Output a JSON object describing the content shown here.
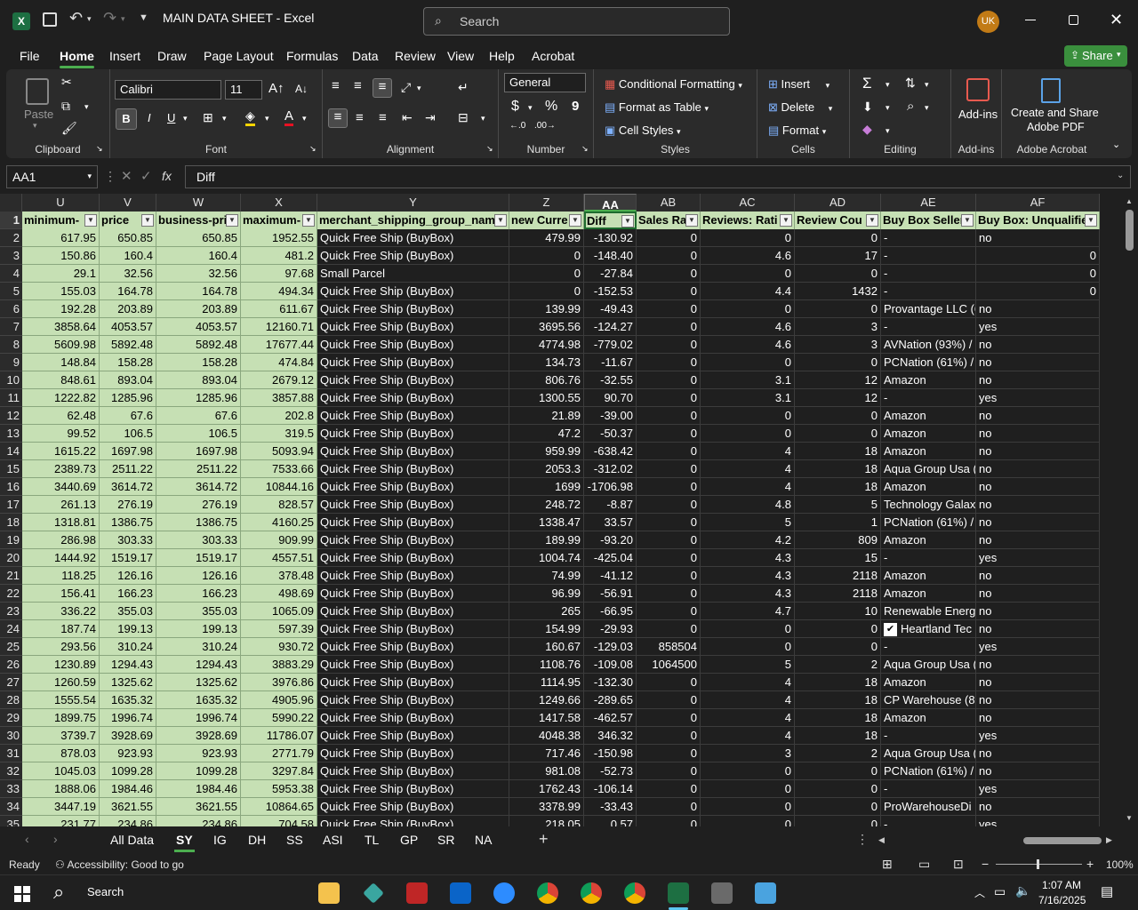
{
  "titlebar": {
    "filename": "MAIN DATA SHEET",
    "sep": "-",
    "app": "Excel",
    "search_placeholder": "Search",
    "avatar": "UK"
  },
  "menu": {
    "tabs": [
      "File",
      "Home",
      "Insert",
      "Draw",
      "Page Layout",
      "Formulas",
      "Data",
      "Review",
      "View",
      "Help",
      "Acrobat"
    ],
    "share": "Share"
  },
  "ribbon": {
    "clipboard": {
      "paste": "Paste",
      "label": "Clipboard"
    },
    "font": {
      "name": "Calibri",
      "size": "11",
      "label": "Font",
      "bold": "B",
      "italic": "I",
      "underline": "U"
    },
    "alignment": {
      "label": "Alignment"
    },
    "number": {
      "format": "General",
      "label": "Number",
      "currency": "$",
      "percent": "%",
      "comma": "9"
    },
    "styles": {
      "conditional": "Conditional Formatting",
      "format_table": "Format as Table",
      "cell_styles": "Cell Styles",
      "label": "Styles"
    },
    "cells": {
      "insert": "Insert",
      "delete": "Delete",
      "format": "Format",
      "label": "Cells"
    },
    "editing": {
      "label": "Editing"
    },
    "addins": {
      "addins": "Add-ins",
      "label": "Add-ins"
    },
    "acrobat": {
      "create": "Create and Share",
      "pdf": "Adobe PDF",
      "label": "Adobe Acrobat"
    }
  },
  "formula_bar": {
    "name_box": "AA1",
    "fx": "fx",
    "content": "Diff"
  },
  "columns": [
    "U",
    "V",
    "W",
    "X",
    "Y",
    "Z",
    "AA",
    "AB",
    "AC",
    "AD",
    "AE",
    "AF"
  ],
  "headers": [
    "minimum-",
    "price",
    "business-pri",
    "maximum-",
    "merchant_shipping_group_nam",
    "new Curre",
    "Diff",
    "Sales Ra",
    "Reviews: Rati",
    "Review Cou",
    "Buy Box Seller",
    "Buy Box: Unqualifie"
  ],
  "rows": [
    [
      "617.95",
      "650.85",
      "650.85",
      "1952.55",
      "Quick Free Ship (BuyBox)",
      "479.99",
      "-130.92",
      "0",
      "0",
      "0",
      "-",
      "no"
    ],
    [
      "150.86",
      "160.4",
      "160.4",
      "481.2",
      "Quick Free Ship (BuyBox)",
      "0",
      "-148.40",
      "0",
      "4.6",
      "17",
      "-",
      "0"
    ],
    [
      "29.1",
      "32.56",
      "32.56",
      "97.68",
      "Small Parcel",
      "0",
      "-27.84",
      "0",
      "0",
      "0",
      "-",
      "0"
    ],
    [
      "155.03",
      "164.78",
      "164.78",
      "494.34",
      "Quick Free Ship (BuyBox)",
      "0",
      "-152.53",
      "0",
      "4.4",
      "1432",
      "-",
      "0"
    ],
    [
      "192.28",
      "203.89",
      "203.89",
      "611.67",
      "Quick Free Ship (BuyBox)",
      "139.99",
      "-49.43",
      "0",
      "0",
      "0",
      "Provantage LLC (6",
      "no"
    ],
    [
      "3858.64",
      "4053.57",
      "4053.57",
      "12160.71",
      "Quick Free Ship (BuyBox)",
      "3695.56",
      "-124.27",
      "0",
      "4.6",
      "3",
      "-",
      "yes"
    ],
    [
      "5609.98",
      "5892.48",
      "5892.48",
      "17677.44",
      "Quick Free Ship (BuyBox)",
      "4774.98",
      "-779.02",
      "0",
      "4.6",
      "3",
      "AVNation (93%) /",
      "no"
    ],
    [
      "148.84",
      "158.28",
      "158.28",
      "474.84",
      "Quick Free Ship (BuyBox)",
      "134.73",
      "-11.67",
      "0",
      "0",
      "0",
      "PCNation (61%) /",
      "no"
    ],
    [
      "848.61",
      "893.04",
      "893.04",
      "2679.12",
      "Quick Free Ship (BuyBox)",
      "806.76",
      "-32.55",
      "0",
      "3.1",
      "12",
      "Amazon",
      "no"
    ],
    [
      "1222.82",
      "1285.96",
      "1285.96",
      "3857.88",
      "Quick Free Ship (BuyBox)",
      "1300.55",
      "90.70",
      "0",
      "3.1",
      "12",
      "-",
      "yes"
    ],
    [
      "62.48",
      "67.6",
      "67.6",
      "202.8",
      "Quick Free Ship (BuyBox)",
      "21.89",
      "-39.00",
      "0",
      "0",
      "0",
      "Amazon",
      "no"
    ],
    [
      "99.52",
      "106.5",
      "106.5",
      "319.5",
      "Quick Free Ship (BuyBox)",
      "47.2",
      "-50.37",
      "0",
      "0",
      "0",
      "Amazon",
      "no"
    ],
    [
      "1615.22",
      "1697.98",
      "1697.98",
      "5093.94",
      "Quick Free Ship (BuyBox)",
      "959.99",
      "-638.42",
      "0",
      "4",
      "18",
      "Amazon",
      "no"
    ],
    [
      "2389.73",
      "2511.22",
      "2511.22",
      "7533.66",
      "Quick Free Ship (BuyBox)",
      "2053.3",
      "-312.02",
      "0",
      "4",
      "18",
      "Aqua Group Usa (",
      "no"
    ],
    [
      "3440.69",
      "3614.72",
      "3614.72",
      "10844.16",
      "Quick Free Ship (BuyBox)",
      "1699",
      "-1706.98",
      "0",
      "4",
      "18",
      "Amazon",
      "no"
    ],
    [
      "261.13",
      "276.19",
      "276.19",
      "828.57",
      "Quick Free Ship (BuyBox)",
      "248.72",
      "-8.87",
      "0",
      "4.8",
      "5",
      "Technology Galax",
      "no"
    ],
    [
      "1318.81",
      "1386.75",
      "1386.75",
      "4160.25",
      "Quick Free Ship (BuyBox)",
      "1338.47",
      "33.57",
      "0",
      "5",
      "1",
      "PCNation (61%) /",
      "no"
    ],
    [
      "286.98",
      "303.33",
      "303.33",
      "909.99",
      "Quick Free Ship (BuyBox)",
      "189.99",
      "-93.20",
      "0",
      "4.2",
      "809",
      "Amazon",
      "no"
    ],
    [
      "1444.92",
      "1519.17",
      "1519.17",
      "4557.51",
      "Quick Free Ship (BuyBox)",
      "1004.74",
      "-425.04",
      "0",
      "4.3",
      "15",
      "-",
      "yes"
    ],
    [
      "118.25",
      "126.16",
      "126.16",
      "378.48",
      "Quick Free Ship (BuyBox)",
      "74.99",
      "-41.12",
      "0",
      "4.3",
      "2118",
      "Amazon",
      "no"
    ],
    [
      "156.41",
      "166.23",
      "166.23",
      "498.69",
      "Quick Free Ship (BuyBox)",
      "96.99",
      "-56.91",
      "0",
      "4.3",
      "2118",
      "Amazon",
      "no"
    ],
    [
      "336.22",
      "355.03",
      "355.03",
      "1065.09",
      "Quick Free Ship (BuyBox)",
      "265",
      "-66.95",
      "0",
      "4.7",
      "10",
      "Renewable Energ",
      "no"
    ],
    [
      "187.74",
      "199.13",
      "199.13",
      "597.39",
      "Quick Free Ship (BuyBox)",
      "154.99",
      "-29.93",
      "0",
      "0",
      "0",
      "Heartland Tec",
      "no"
    ],
    [
      "293.56",
      "310.24",
      "310.24",
      "930.72",
      "Quick Free Ship (BuyBox)",
      "160.67",
      "-129.03",
      "858504",
      "0",
      "0",
      "-",
      "yes"
    ],
    [
      "1230.89",
      "1294.43",
      "1294.43",
      "3883.29",
      "Quick Free Ship (BuyBox)",
      "1108.76",
      "-109.08",
      "1064500",
      "5",
      "2",
      "Aqua Group Usa (",
      "no"
    ],
    [
      "1260.59",
      "1325.62",
      "1325.62",
      "3976.86",
      "Quick Free Ship (BuyBox)",
      "1114.95",
      "-132.30",
      "0",
      "4",
      "18",
      "Amazon",
      "no"
    ],
    [
      "1555.54",
      "1635.32",
      "1635.32",
      "4905.96",
      "Quick Free Ship (BuyBox)",
      "1249.66",
      "-289.65",
      "0",
      "4",
      "18",
      "CP Warehouse (8",
      "no"
    ],
    [
      "1899.75",
      "1996.74",
      "1996.74",
      "5990.22",
      "Quick Free Ship (BuyBox)",
      "1417.58",
      "-462.57",
      "0",
      "4",
      "18",
      "Amazon",
      "no"
    ],
    [
      "3739.7",
      "3928.69",
      "3928.69",
      "11786.07",
      "Quick Free Ship (BuyBox)",
      "4048.38",
      "346.32",
      "0",
      "4",
      "18",
      "-",
      "yes"
    ],
    [
      "878.03",
      "923.93",
      "923.93",
      "2771.79",
      "Quick Free Ship (BuyBox)",
      "717.46",
      "-150.98",
      "0",
      "3",
      "2",
      "Aqua Group Usa (",
      "no"
    ],
    [
      "1045.03",
      "1099.28",
      "1099.28",
      "3297.84",
      "Quick Free Ship (BuyBox)",
      "981.08",
      "-52.73",
      "0",
      "0",
      "0",
      "PCNation (61%) /",
      "no"
    ],
    [
      "1888.06",
      "1984.46",
      "1984.46",
      "5953.38",
      "Quick Free Ship (BuyBox)",
      "1762.43",
      "-106.14",
      "0",
      "0",
      "0",
      "-",
      "yes"
    ],
    [
      "3447.19",
      "3621.55",
      "3621.55",
      "10864.65",
      "Quick Free Ship (BuyBox)",
      "3378.99",
      "-33.43",
      "0",
      "0",
      "0",
      "ProWarehouseDi",
      "no"
    ],
    [
      "231.77",
      "234.86",
      "234.86",
      "704.58",
      "Quick Free Ship (BuyBox)",
      "218.05",
      "0.57",
      "0",
      "0",
      "0",
      "-",
      "yes"
    ]
  ],
  "sheet_tabs": [
    "All Data",
    "SY",
    "IG",
    "DH",
    "SS",
    "ASI",
    "TL",
    "GP",
    "SR",
    "NA"
  ],
  "status": {
    "ready": "Ready",
    "accessibility": "Accessibility: Good to go",
    "zoom": "100%"
  },
  "taskbar": {
    "search": "Search",
    "time": "1:07 AM",
    "date": "7/16/2025"
  }
}
